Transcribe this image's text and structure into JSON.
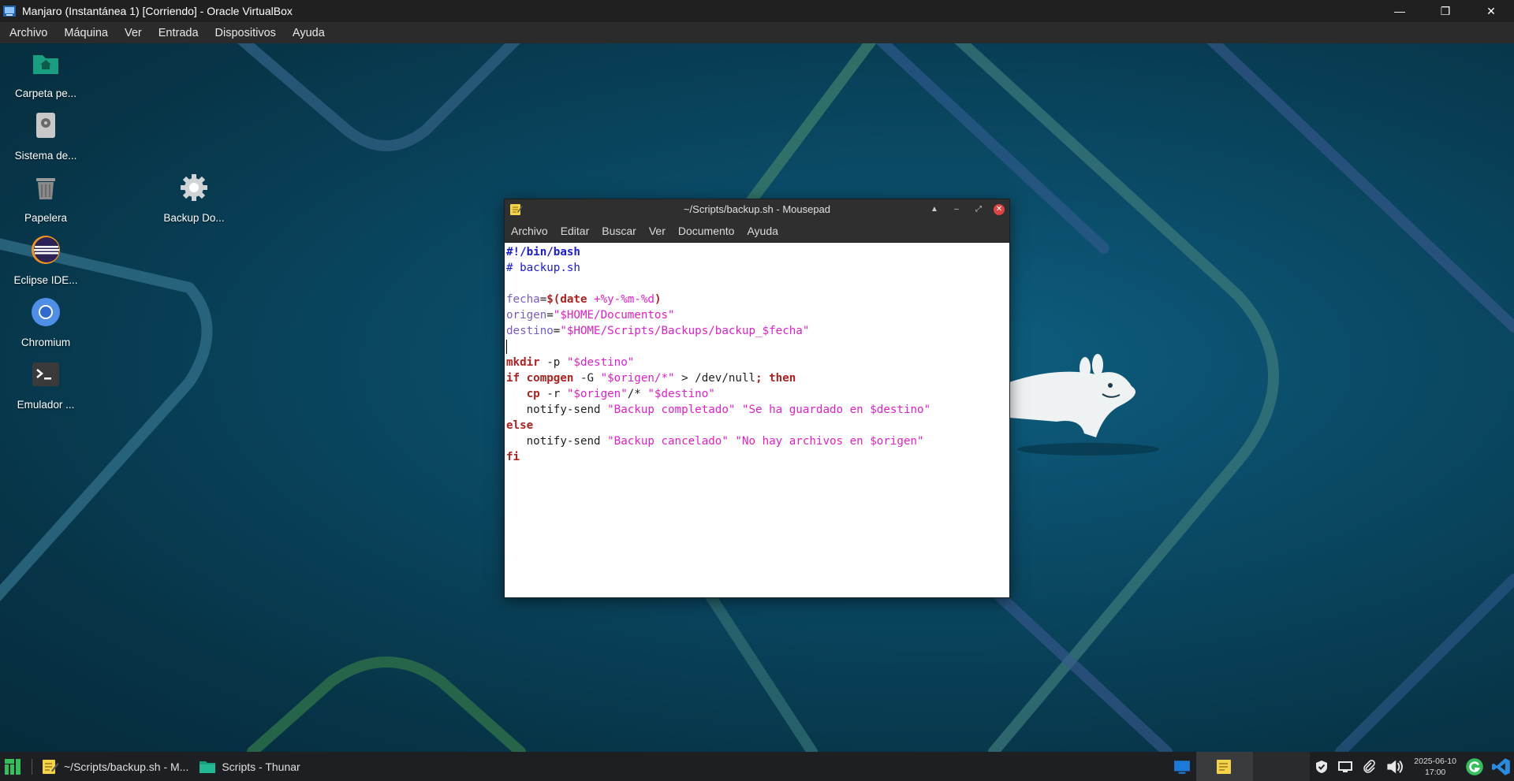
{
  "host": {
    "title": "Manjaro (Instantánea 1) [Corriendo] - Oracle VirtualBox",
    "menu": [
      "Archivo",
      "Máquina",
      "Ver",
      "Entrada",
      "Dispositivos",
      "Ayuda"
    ],
    "controls": {
      "minimize": "—",
      "restore": "❐",
      "close": "✕"
    }
  },
  "desktop": {
    "icons": [
      {
        "label": "Carpeta pe...",
        "icon": "home-folder-icon"
      },
      {
        "label": "Sistema de...",
        "icon": "filesystem-drive-icon"
      },
      {
        "label": "Papelera",
        "icon": "trash-icon"
      },
      {
        "label": "Eclipse IDE...",
        "icon": "eclipse-icon"
      },
      {
        "label": "Chromium",
        "icon": "chromium-icon"
      },
      {
        "label": "Emulador ...",
        "icon": "terminal-icon"
      },
      {
        "label": "Backup Do...",
        "icon": "gear-icon"
      }
    ]
  },
  "mousepad": {
    "title": "~/Scripts/backup.sh - Mousepad",
    "menu": [
      "Archivo",
      "Editar",
      "Buscar",
      "Ver",
      "Documento",
      "Ayuda"
    ],
    "controls": {
      "shade": "▲",
      "minimize": "–",
      "maximize": "⤢",
      "close": "✕"
    },
    "code": {
      "l1": "#!/bin/bash",
      "l2": "# backup.sh",
      "l4_var": "fecha",
      "l4_eq": "=",
      "l4_cmd": "$(date ",
      "l4_fmt": "+%y-%m-%d",
      "l4_close": ")",
      "l5_var": "origen",
      "l5_eq": "=",
      "l5_str": "\"$HOME/Documentos\"",
      "l6_var": "destino",
      "l6_eq": "=",
      "l6_str": "\"$HOME/Scripts/Backups/backup_$fecha\"",
      "l8_kw": "mkdir",
      "l8_plain": " -p ",
      "l8_str": "\"$destino\"",
      "l9_kw1": "if compgen",
      "l9_plain1": " -G ",
      "l9_str": "\"$origen/*\"",
      "l9_plain2": " > /dev/null",
      "l9_kw2": "; then",
      "l10_indent": "   ",
      "l10_kw": "cp",
      "l10_plain1": " -r ",
      "l10_str1": "\"$origen\"",
      "l10_plain2": "/* ",
      "l10_str2": "\"$destino\"",
      "l11_plain": "   notify-send ",
      "l11_str1": "\"Backup completado\"",
      "l11_sp": " ",
      "l11_str2": "\"Se ha guardado en $destino\"",
      "l12_kw": "else",
      "l13_plain": "   notify-send ",
      "l13_str1": "\"Backup cancelado\"",
      "l13_sp": " ",
      "l13_str2": "\"No hay archivos en $origen\"",
      "l14_kw": "fi"
    }
  },
  "taskbar": {
    "tasks": [
      {
        "label": "~/Scripts/backup.sh - M...",
        "icon": "mousepad-icon"
      },
      {
        "label": "Scripts - Thunar",
        "icon": "folder-icon"
      }
    ],
    "clock": {
      "date": "2025-06-10",
      "time": "17:00"
    }
  },
  "colors": {
    "accent": "#1abc9c",
    "close": "#e04343",
    "keyword": "#b02020",
    "string": "#e020c8",
    "variable": "#7a5cc8",
    "comment": "#1a1ad6"
  }
}
